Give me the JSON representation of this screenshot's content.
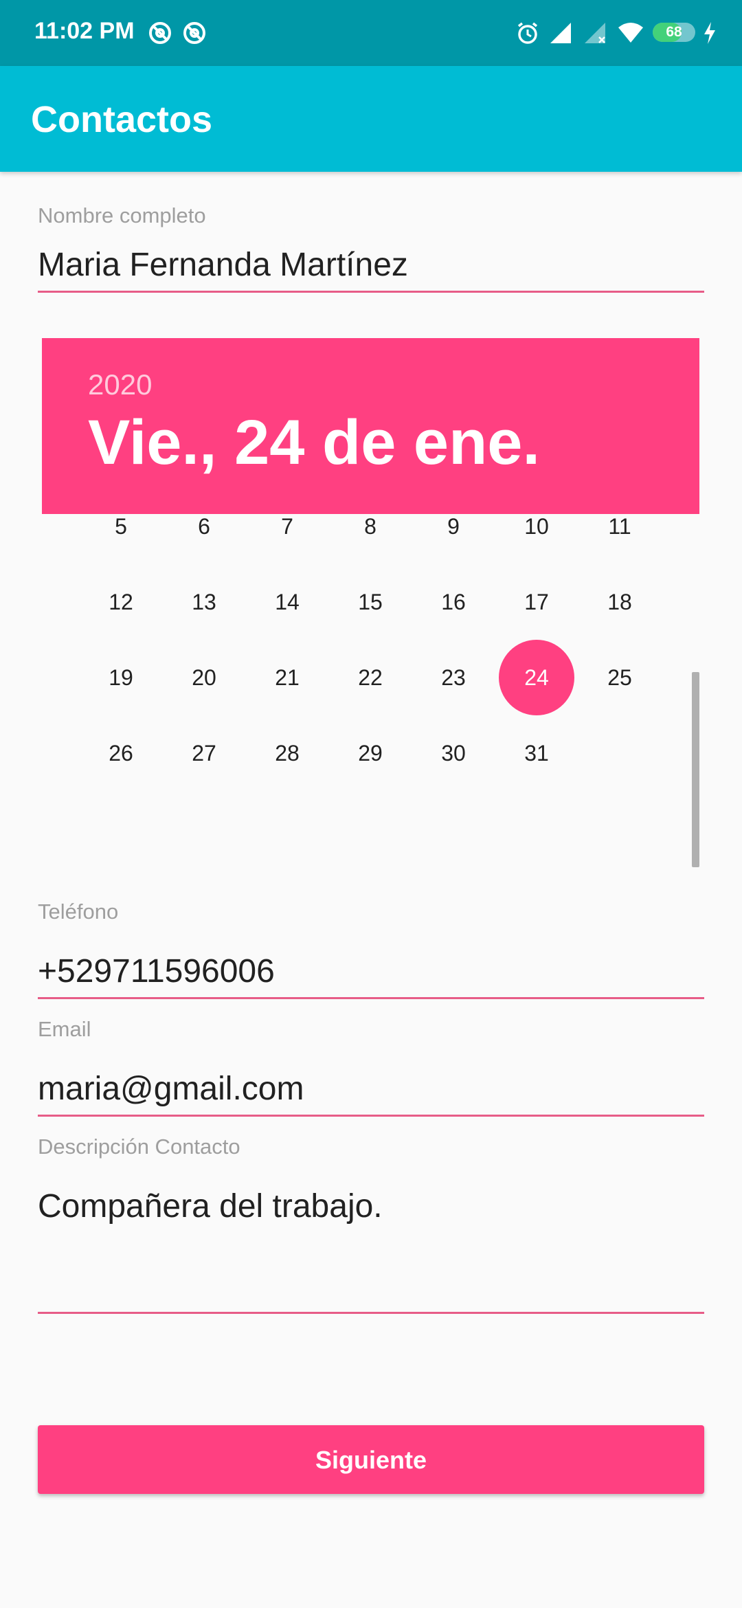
{
  "status_bar": {
    "time": "11:02 PM",
    "battery": "68",
    "icons": [
      "at-icon",
      "at-icon",
      "alarm-icon",
      "signal-icon",
      "signal-icon-no-data",
      "wifi-icon",
      "battery-icon",
      "charging-icon"
    ]
  },
  "app_bar": {
    "title": "Contactos"
  },
  "form": {
    "name_label": "Nombre completo",
    "name_value": "Maria Fernanda Martínez",
    "phone_label": "Teléfono",
    "phone_value": "+529711596006",
    "email_label": "Email",
    "email_value": "maria@gmail.com",
    "description_label": "Descripción Contacto",
    "description_value": "Compañera del trabajo."
  },
  "date_picker": {
    "year": "2020",
    "selected_date": "Vie., 24 de ene.",
    "weeks": [
      [
        "5",
        "6",
        "7",
        "8",
        "9",
        "10",
        "11"
      ],
      [
        "12",
        "13",
        "14",
        "15",
        "16",
        "17",
        "18"
      ],
      [
        "19",
        "20",
        "21",
        "22",
        "23",
        "24",
        "25"
      ],
      [
        "26",
        "27",
        "28",
        "29",
        "30",
        "31"
      ]
    ],
    "selected_day": "24"
  },
  "button": {
    "next_label": "Siguiente"
  },
  "colors": {
    "status_bar": "#0097a7",
    "app_bar": "#00bcd4",
    "accent": "#ff4081",
    "underline": "#e75c87",
    "background": "#fafafa"
  }
}
